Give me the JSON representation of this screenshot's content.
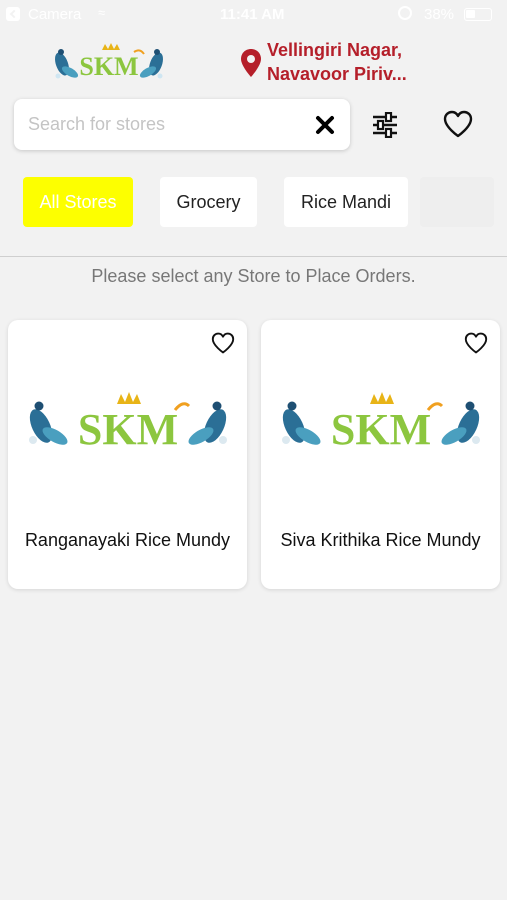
{
  "status_bar": {
    "carrier": "Camera",
    "time": "11:41 AM",
    "battery": "38%"
  },
  "header": {
    "logo_text": "SKM",
    "location_line1": "Vellingiri Nagar,",
    "location_line2": "Navavoor Piriv..."
  },
  "search": {
    "placeholder": "Search for stores",
    "value": ""
  },
  "tabs": [
    {
      "label": "All Stores",
      "active": true
    },
    {
      "label": "Grocery",
      "active": false
    },
    {
      "label": "Rice Mandi",
      "active": false
    }
  ],
  "info_message": "Please select any Store to Place Orders.",
  "stores": [
    {
      "name": "Ranganayaki Rice Mundy",
      "logo_text": "SKM"
    },
    {
      "name": "Siva Krithika Rice Mundy",
      "logo_text": "SKM"
    }
  ],
  "colors": {
    "accent": "#b51f2a",
    "active_tab": "#fdff00",
    "logo_green": "#8cc63f",
    "background": "#f2f2f2"
  },
  "icons": {
    "clear": "close-icon",
    "filter": "filter-sliders-icon",
    "favorites": "heart-icon",
    "location": "location-pin-icon"
  }
}
